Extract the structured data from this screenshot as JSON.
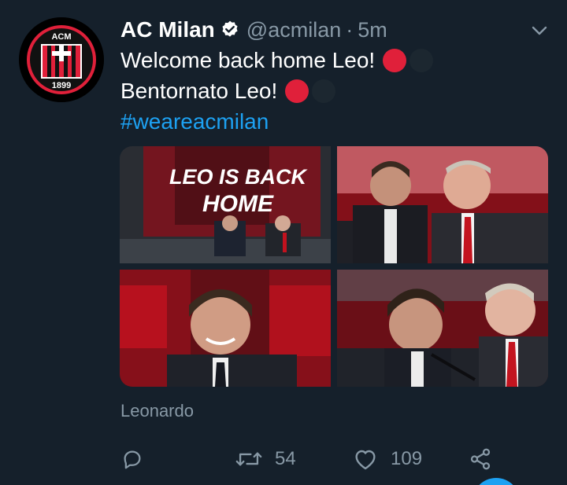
{
  "tweet": {
    "display_name": "AC Milan",
    "verified_icon": "verified-badge-icon",
    "handle": "@acmilan",
    "separator": "·",
    "time": "5m",
    "line1": "Welcome back home Leo!",
    "line2": "Bentornato Leo!",
    "hashtag": "#weareacmilan",
    "caption": "Leonardo",
    "retweet_count": "54",
    "like_count": "109"
  },
  "avatar": {
    "logo_text_top": "ACM",
    "logo_text_bottom": "1899"
  },
  "media": {
    "photo1_text_line1": "LEO IS BACK",
    "photo1_text_line2": "HOME"
  },
  "colors": {
    "background": "#15202b",
    "accent": "#1da1f2",
    "secondary_text": "#8899a6",
    "milan_red": "#e0203a"
  },
  "icons": {
    "reply": "reply-icon",
    "retweet": "retweet-icon",
    "like": "heart-icon",
    "share": "share-icon",
    "menu": "chevron-down-icon"
  }
}
